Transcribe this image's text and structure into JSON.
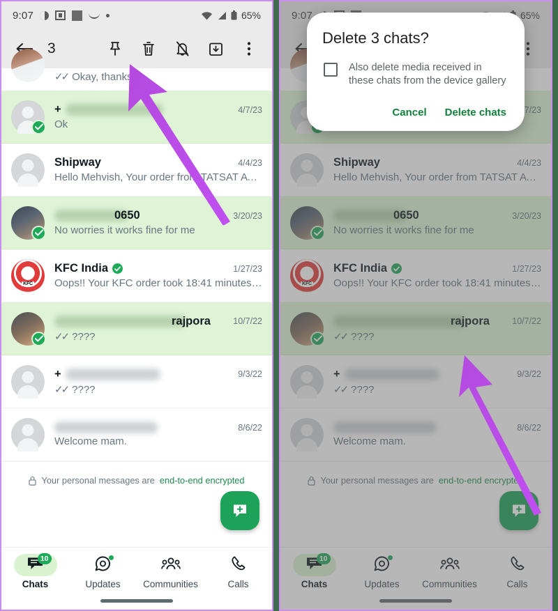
{
  "status_bar": {
    "time": "9:07",
    "battery_percent": "65%",
    "icons": [
      "dnd-icon",
      "screenshot-frame-icon",
      "square-icon",
      "curve-icon",
      "dot-icon",
      "wifi-icon",
      "cellular-signal-icon",
      "battery-icon"
    ]
  },
  "toolbar": {
    "back_label": "back-arrow",
    "selection_count": "3",
    "actions": [
      {
        "name": "pin-icon",
        "label": "Pin"
      },
      {
        "name": "delete-icon",
        "label": "Delete"
      },
      {
        "name": "mute-icon",
        "label": "Mute notifications"
      },
      {
        "name": "archive-icon",
        "label": "Archive"
      },
      {
        "name": "more-options-icon",
        "label": "More options"
      }
    ]
  },
  "chats": [
    {
      "name": "",
      "name_blurred": true,
      "blur_width": 0,
      "message": "Okay, thanks.",
      "time": "",
      "selected": false,
      "ticks": "✓✓",
      "avatar": "photo-a",
      "partial": true
    },
    {
      "name": "+",
      "name_blurred": true,
      "blur_width": 140,
      "message": "Ok",
      "time": "4/7/23",
      "selected": true,
      "ticks": "",
      "avatar": "placeholder"
    },
    {
      "name": "Shipway",
      "name_blurred": false,
      "blur_width": 0,
      "message": "Hello Mehvish,   Your order from TATSAT AYU…",
      "time": "4/4/23",
      "selected": false,
      "ticks": "",
      "avatar": "placeholder"
    },
    {
      "name": "0650",
      "name_blurred": true,
      "blur_width": 106,
      "message": "No worries it works fine for me",
      "time": "3/20/23",
      "selected": true,
      "ticks": "",
      "avatar": "photo-b"
    },
    {
      "name": "KFC India",
      "name_blurred": false,
      "blur_width": 0,
      "verified": true,
      "message": "Oops!! Your KFC order took 18:41 minutes. We…",
      "time": "1/27/23",
      "selected": false,
      "ticks": "",
      "avatar": "kfc"
    },
    {
      "name": "rajpora",
      "name_blurred": true,
      "blur_width": 188,
      "message": "????",
      "time": "10/7/22",
      "selected": true,
      "ticks": "✓✓",
      "avatar": "photo-c"
    },
    {
      "name": "+",
      "name_blurred": true,
      "blur_width": 136,
      "message": "????",
      "time": "9/3/22",
      "selected": false,
      "ticks": "✓✓",
      "avatar": "placeholder"
    },
    {
      "name": "",
      "name_blurred": true,
      "blur_width": 148,
      "message": "Welcome mam.",
      "time": "8/6/22",
      "selected": false,
      "ticks": "",
      "avatar": "placeholder"
    }
  ],
  "encryption_footer": {
    "prefix": "Your personal messages are",
    "highlight": "end-to-end encrypted",
    "icon": "lock-icon"
  },
  "fab": {
    "name": "new-chat-fab",
    "icon": "new-chat-icon"
  },
  "bottom_nav": [
    {
      "label": "Chats",
      "icon": "chats-icon",
      "badge": "10",
      "active": true,
      "dot": false
    },
    {
      "label": "Updates",
      "icon": "updates-icon",
      "badge": "",
      "active": false,
      "dot": true
    },
    {
      "label": "Communities",
      "icon": "communities-icon",
      "badge": "",
      "active": false,
      "dot": false
    },
    {
      "label": "Calls",
      "icon": "calls-icon",
      "badge": "",
      "active": false,
      "dot": false
    }
  ],
  "dialog": {
    "title": "Delete 3 chats?",
    "checkbox_label": "Also delete media received in these chats from the device gallery",
    "checkbox_checked": false,
    "cancel_label": "Cancel",
    "confirm_label": "Delete chats"
  },
  "annotations": {
    "arrow_color": "#b44ae0",
    "left_arrow_target": "delete-icon",
    "right_arrow_target": "delete-chats-button"
  },
  "colors": {
    "selected_row": "#dff4d7",
    "brand_green": "#1faa59",
    "accent_purple": "#b44ae0",
    "panel_border": "#c98ef0",
    "divider_green": "#3f6d4e"
  }
}
